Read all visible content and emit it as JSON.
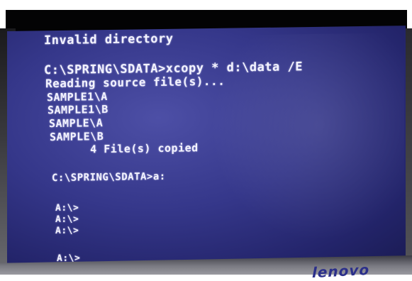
{
  "terminal": {
    "lines": [
      "Invalid directory",
      "C:\\SPRING\\SDATA>xcopy * d:\\data /E",
      "Reading source file(s)...",
      "SAMPLE1\\A",
      "SAMPLE1\\B",
      "SAMPLE\\A",
      "SAMPLE\\B",
      "      4 File(s) copied",
      "C:\\SPRING\\SDATA>a:",
      "A:\\>",
      "A:\\>",
      "A:\\>",
      "A:\\>"
    ]
  },
  "monitor": {
    "brand": "lenovo"
  },
  "colors": {
    "screen_background": "#35378a",
    "text": "#f3f3ff"
  }
}
